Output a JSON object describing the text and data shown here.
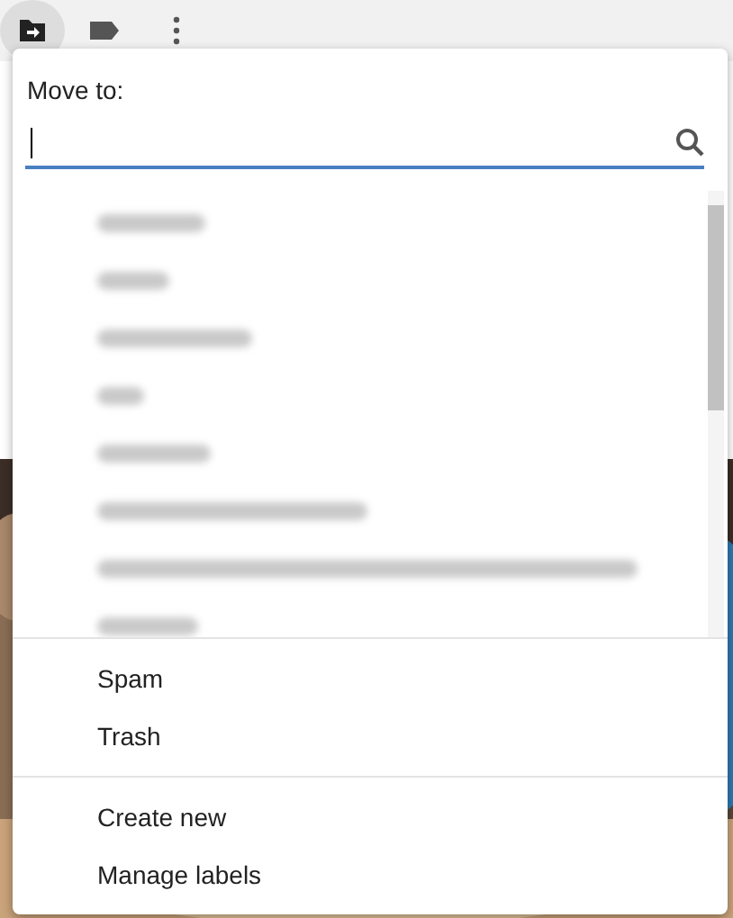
{
  "toolbar": {
    "items": [
      {
        "kind": "move",
        "selected": true
      },
      {
        "kind": "label",
        "selected": false
      },
      {
        "kind": "more",
        "selected": false
      }
    ]
  },
  "move_menu": {
    "title": "Move to:",
    "search": {
      "focused": true
    },
    "labels": [
      {
        "kind": "blurred"
      },
      {
        "kind": "blurred"
      },
      {
        "kind": "blurred"
      },
      {
        "kind": "blurred"
      },
      {
        "kind": "blurred"
      },
      {
        "kind": "blurred"
      },
      {
        "kind": "blurred"
      },
      {
        "kind": "blurred"
      }
    ],
    "system_items": [
      "Spam",
      "Trash"
    ],
    "actions": [
      "Create new",
      "Manage labels"
    ]
  }
}
